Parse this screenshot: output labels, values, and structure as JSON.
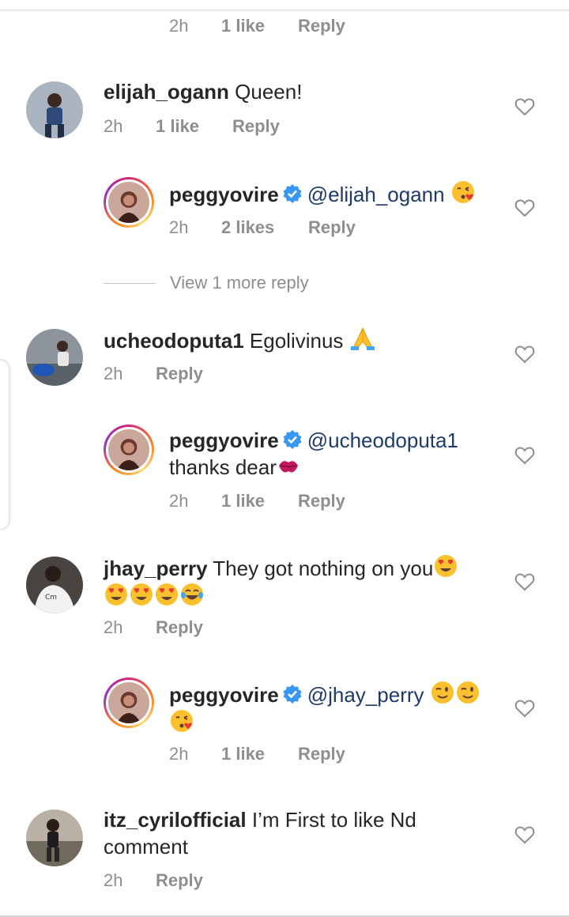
{
  "top_meta": {
    "time": "2h",
    "likes": "1 like",
    "reply": "Reply"
  },
  "comments": [
    {
      "username": "elijah_ogann",
      "text": "Queen!",
      "time": "2h",
      "likes": "1 like",
      "reply": "Reply",
      "reply_item": {
        "username": "peggyovire",
        "mention": "@elijah_ogann",
        "text_after": "",
        "time": "2h",
        "likes": "2 likes",
        "reply": "Reply"
      },
      "view_more": "View 1 more reply"
    },
    {
      "username": "ucheodoputa1",
      "text": "Egolivinus",
      "time": "2h",
      "likes": "",
      "reply": "Reply",
      "reply_item": {
        "username": "peggyovire",
        "mention": "@ucheodoputa1",
        "text_after": "thanks dear",
        "time": "2h",
        "likes": "1 like",
        "reply": "Reply"
      }
    },
    {
      "username": "jhay_perry",
      "text": "They got nothing on you",
      "time": "2h",
      "likes": "",
      "reply": "Reply",
      "reply_item": {
        "username": "peggyovire",
        "mention": "@jhay_perry",
        "text_after": "",
        "time": "2h",
        "likes": "1 like",
        "reply": "Reply"
      }
    },
    {
      "username": "itz_cyrilofficial",
      "text": "I’m First to like Nd",
      "text_line2": "comment",
      "time": "2h",
      "likes": "",
      "reply": "Reply"
    }
  ],
  "icons": {
    "like": "heart-outline-icon",
    "verified": "verified-badge-icon"
  },
  "colors": {
    "verified": "#3897f0",
    "mention": "#1e3a6b",
    "muted": "#8e8e8e"
  }
}
